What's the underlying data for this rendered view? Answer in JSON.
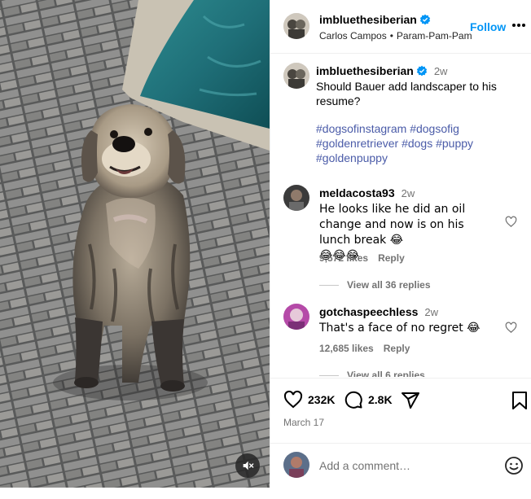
{
  "post": {
    "author": "imbluethesiberian",
    "subtitle_author": "Carlos Campos",
    "subtitle_separator": "•",
    "subtitle_song": "Param-Pam-Pam",
    "follow_label": "Follow",
    "more_icon": "more-horizontal-icon"
  },
  "caption": {
    "username": "imbluethesiberian",
    "time": "2w",
    "text": "Should Bauer add landscaper to his resume?",
    "hashtags": [
      "#dogsofinstagram",
      "#dogsofig",
      "#goldenretriever",
      "#dogs",
      "#puppy",
      "#goldenpuppy"
    ]
  },
  "comments": [
    {
      "username": "meldacosta93",
      "time": "2w",
      "text": "He looks like he did an oil change and now is on his lunch break 😂",
      "text_line2": "😂😂😂",
      "likes": "9,572 likes",
      "reply_label": "Reply",
      "view_replies": "View all 36 replies"
    },
    {
      "username": "gotchaspeechless",
      "time": "2w",
      "text": "That's a face of no regret 😂",
      "likes": "12,685 likes",
      "reply_label": "Reply",
      "view_replies": "View all 6 replies"
    }
  ],
  "actions": {
    "likes_count": "232K",
    "comments_count": "2.8K",
    "date": "March 17"
  },
  "add_comment": {
    "placeholder": "Add a comment…"
  },
  "colors": {
    "accent": "#0095f6",
    "hashtag": "#4a5ba8",
    "verified": "#0095f6",
    "muted": "#737373",
    "pool": "#1f7a80"
  },
  "icons": [
    "verified-badge-icon",
    "heart-icon",
    "comment-icon",
    "share-icon",
    "bookmark-icon",
    "emoji-icon",
    "mute-icon"
  ]
}
